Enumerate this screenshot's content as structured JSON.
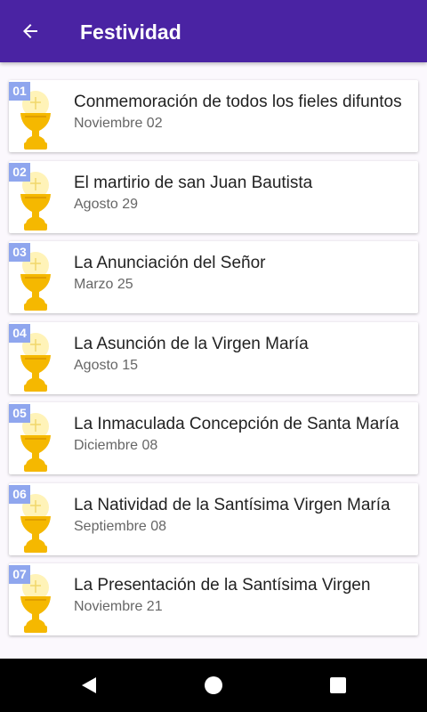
{
  "appbar": {
    "title": "Festividad",
    "back_icon": "arrow-back-icon"
  },
  "items": [
    {
      "num": "01",
      "title": "Conmemoración de todos los fieles difuntos",
      "date": "Noviembre 02",
      "icon": "chalice-icon"
    },
    {
      "num": "02",
      "title": "El martirio de san Juan Bautista",
      "date": "Agosto 29",
      "icon": "chalice-icon"
    },
    {
      "num": "03",
      "title": "La Anunciación del Señor",
      "date": "Marzo 25",
      "icon": "chalice-icon"
    },
    {
      "num": "04",
      "title": "La Asunción de la Virgen María",
      "date": "Agosto 15",
      "icon": "chalice-icon"
    },
    {
      "num": "05",
      "title": "La Inmaculada Concepción de Santa María",
      "date": "Diciembre 08",
      "icon": "chalice-icon"
    },
    {
      "num": "06",
      "title": "La Natividad de la Santísima Virgen María",
      "date": "Septiembre 08",
      "icon": "chalice-icon"
    },
    {
      "num": "07",
      "title": "La Presentación de la Santísima Virgen",
      "date": "Noviembre 21",
      "icon": "chalice-icon"
    }
  ],
  "colors": {
    "appbar": "#4a23a3",
    "badge": "#8fa6ee",
    "chalice": "#f5b800",
    "host": "#fff3b8"
  },
  "navbar": {
    "back_icon": "nav-back-icon",
    "home_icon": "nav-home-icon",
    "recents_icon": "nav-recents-icon"
  }
}
